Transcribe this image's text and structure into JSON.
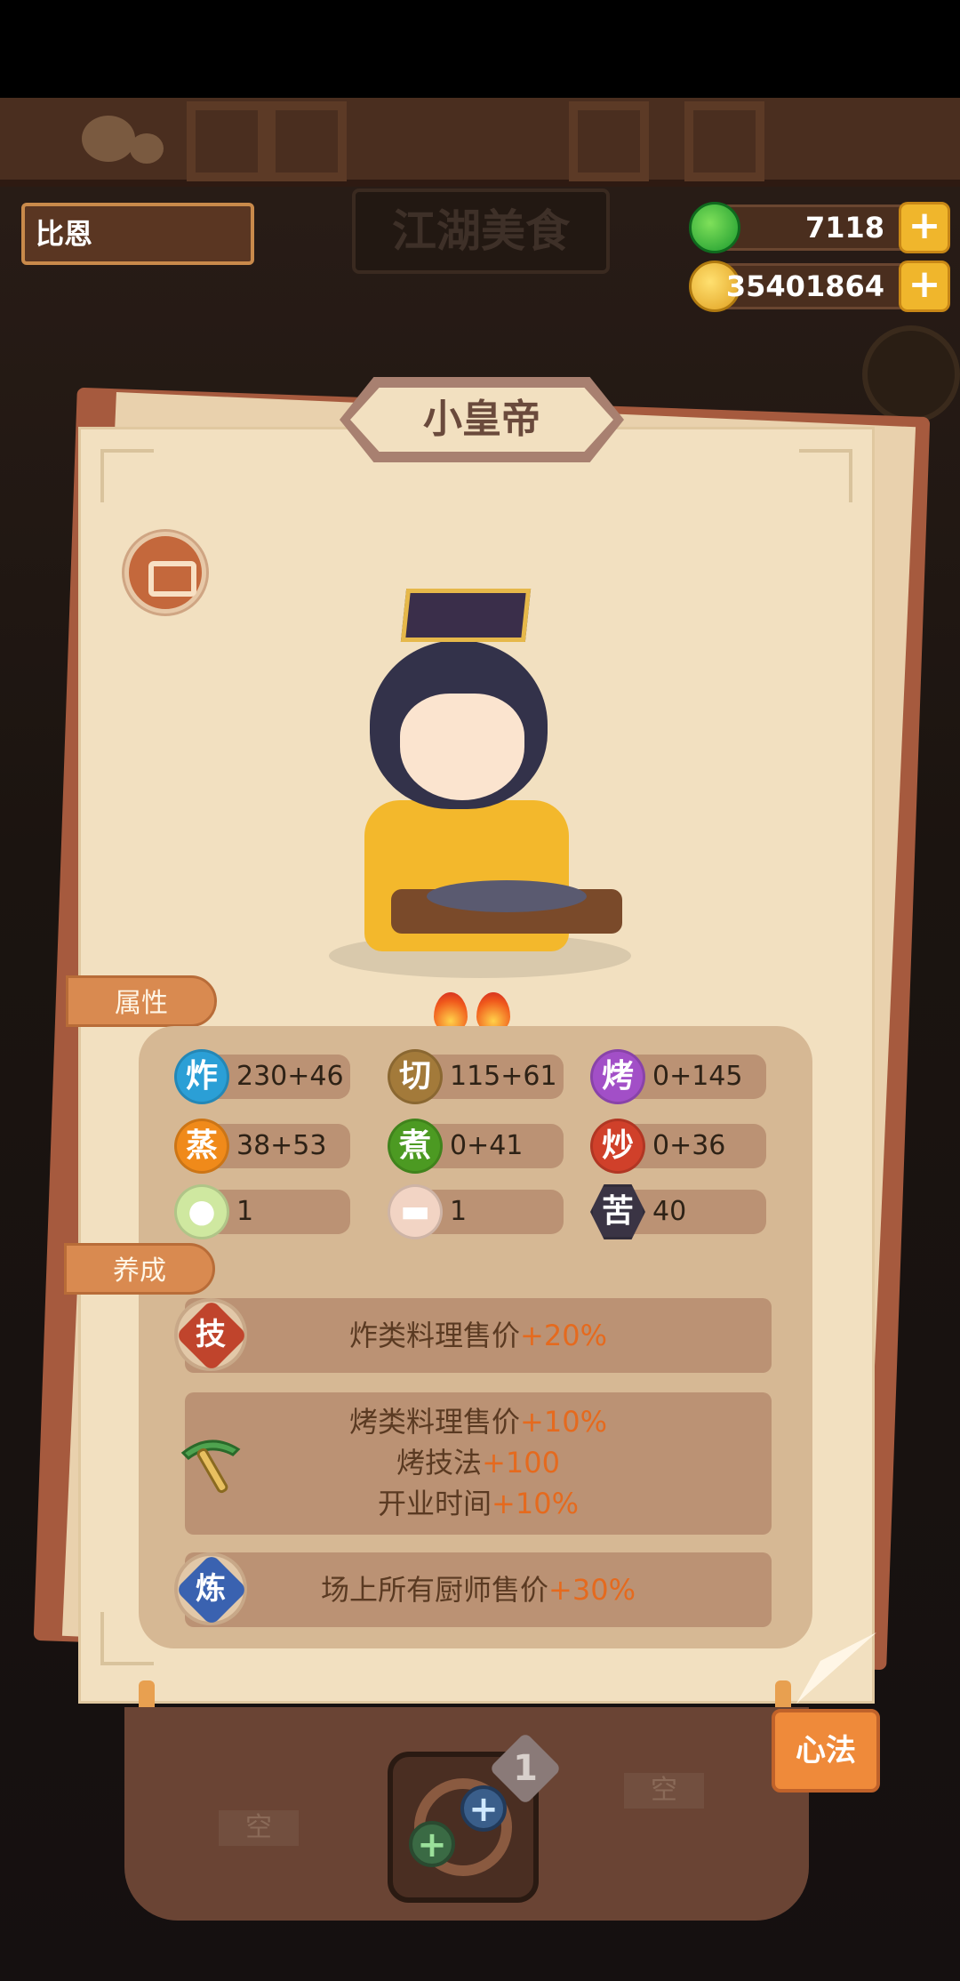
{
  "header": {
    "player_name": "比恩",
    "shop_sign": "江湖美食",
    "jade": "7118",
    "coins": "35401864",
    "add_symbol": "+"
  },
  "card": {
    "title": "小皇帝",
    "heat_level": 2
  },
  "tabs": {
    "attributes": "属性",
    "training": "养成"
  },
  "stats": [
    {
      "icon": "炸",
      "value": "230+46",
      "color": "#2b9fd6"
    },
    {
      "icon": "切",
      "value": "115+61",
      "color": "#a37a3a"
    },
    {
      "icon": "烤",
      "value": "0+145",
      "color": "#a24fc7"
    },
    {
      "icon": "蒸",
      "value": "38+53",
      "color": "#f08a1a"
    },
    {
      "icon": "煮",
      "value": "0+41",
      "color": "#4c9a22"
    },
    {
      "icon": "炒",
      "value": "0+36",
      "color": "#d0402a"
    },
    {
      "icon": "cabbage-icon",
      "value": "1"
    },
    {
      "icon": "meat-icon",
      "value": "1"
    },
    {
      "icon": "苦",
      "value": "40",
      "color": "#3a3444"
    }
  ],
  "training": [
    {
      "icon": "技",
      "line1": "炸类料理售价",
      "hi1": "+20%"
    },
    {
      "icon": "pickaxe-icon",
      "line1": "烤类料理售价",
      "hi1": "+10%",
      "line2": "烤技法",
      "hi2": "+100",
      "line3": "开业时间",
      "hi3": "+10%"
    },
    {
      "icon": "炼",
      "line1": "场上所有厨师售价",
      "hi1": "+30%"
    }
  ],
  "bottom": {
    "empty_left": "空",
    "empty_right": "空",
    "slot_level": "1",
    "add_symbol": "+",
    "heart_method_button": "心法"
  }
}
